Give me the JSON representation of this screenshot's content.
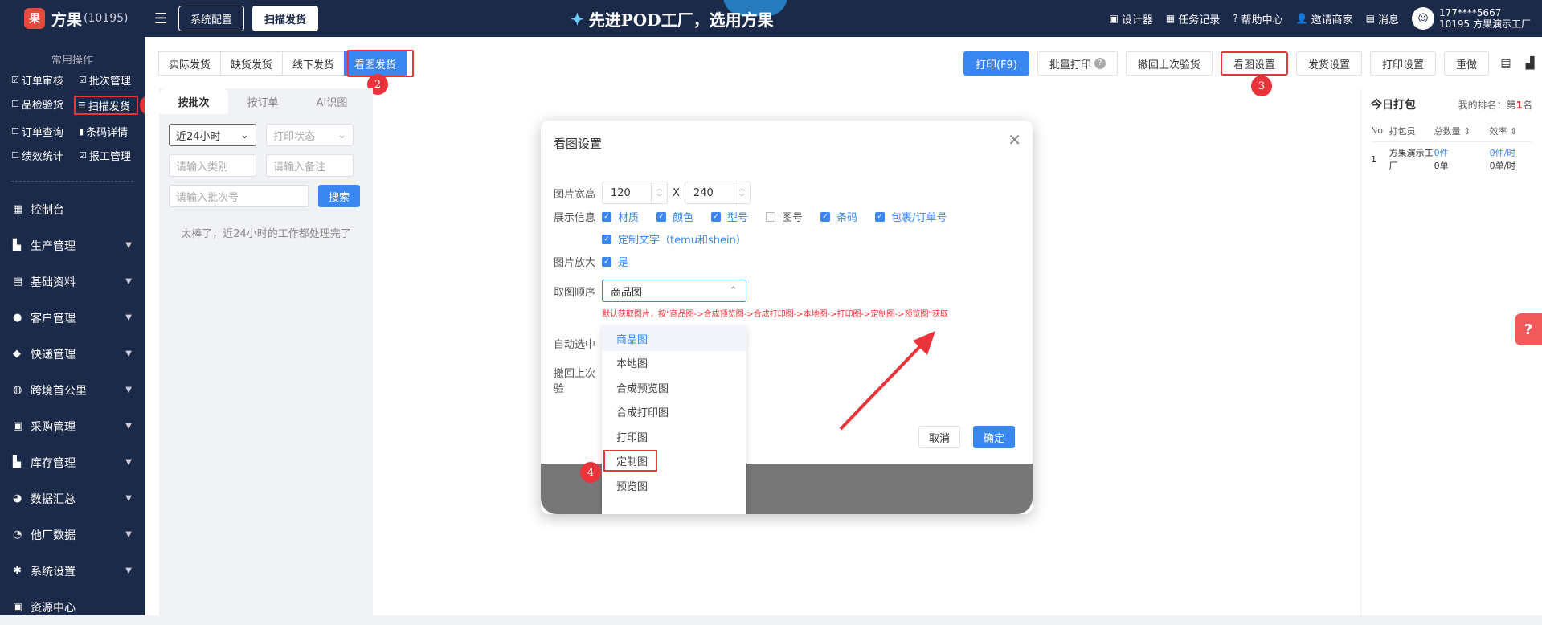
{
  "header": {
    "logo_icon": "果",
    "logo_text": "方果",
    "logo_count": "(10195)",
    "menu_icon": "☰",
    "nav_buttons": [
      "系统配置",
      "扫描发货"
    ],
    "slogan": "先进POD工厂，选用方果",
    "links": [
      {
        "icon": "image-icon",
        "glyph": "▣",
        "label": "设计器"
      },
      {
        "icon": "task-icon",
        "glyph": "▦",
        "label": "任务记录"
      },
      {
        "icon": "help-icon",
        "glyph": "?",
        "label": "帮助中心"
      },
      {
        "icon": "invite-icon",
        "glyph": "👤",
        "label": "邀请商家"
      },
      {
        "icon": "message-icon",
        "glyph": "▤",
        "label": "消息"
      }
    ],
    "user": {
      "phone": "177****5667",
      "company": "10195 方果演示工厂"
    }
  },
  "sidebar": {
    "quick_title": "常用操作",
    "quick_items": [
      {
        "label": "订单审核",
        "glyph": "☑"
      },
      {
        "label": "批次管理",
        "glyph": "☑"
      },
      {
        "label": "品检验货",
        "glyph": "☐"
      },
      {
        "label": "扫描发货",
        "glyph": "☰"
      },
      {
        "label": "订单查询",
        "glyph": "☐"
      },
      {
        "label": "条码详情",
        "glyph": "▮"
      },
      {
        "label": "绩效统计",
        "glyph": "☐"
      },
      {
        "label": "报工管理",
        "glyph": "☑"
      }
    ],
    "nav_items": [
      {
        "label": "控制台",
        "icon": "dashboard-icon",
        "glyph": "▦",
        "chevron": false
      },
      {
        "label": "生产管理",
        "icon": "production-icon",
        "glyph": "▙",
        "chevron": true
      },
      {
        "label": "基础资料",
        "icon": "database-icon",
        "glyph": "▤",
        "chevron": true
      },
      {
        "label": "客户管理",
        "icon": "customer-icon",
        "glyph": "●",
        "chevron": true
      },
      {
        "label": "快递管理",
        "icon": "express-icon",
        "glyph": "◆",
        "chevron": true
      },
      {
        "label": "跨境首公里",
        "icon": "globe-icon",
        "glyph": "◍",
        "chevron": true
      },
      {
        "label": "采购管理",
        "icon": "purchase-icon",
        "glyph": "▣",
        "chevron": true
      },
      {
        "label": "库存管理",
        "icon": "inventory-icon",
        "glyph": "▙",
        "chevron": true
      },
      {
        "label": "数据汇总",
        "icon": "chart-icon",
        "glyph": "◕",
        "chevron": true
      },
      {
        "label": "他厂数据",
        "icon": "other-factory-icon",
        "glyph": "◔",
        "chevron": true
      },
      {
        "label": "系统设置",
        "icon": "settings-icon",
        "glyph": "✱",
        "chevron": true
      },
      {
        "label": "资源中心",
        "icon": "resource-icon",
        "glyph": "▣",
        "chevron": false
      }
    ]
  },
  "tabs": [
    "实际发货",
    "缺货发货",
    "线下发货",
    "看图发货"
  ],
  "actions": {
    "print": "打印(F9)",
    "batch_print": "批量打印",
    "undo_check": "撤回上次验货",
    "view_settings": "看图设置",
    "ship_settings": "发货设置",
    "print_settings": "打印设置",
    "redo": "重做"
  },
  "badges": [
    "1",
    "2",
    "3",
    "4"
  ],
  "left_panel": {
    "tabs": [
      "按批次",
      "按订单",
      "AI识图"
    ],
    "time_select": "近24小时",
    "print_status_placeholder": "打印状态",
    "category_placeholder": "请输入类别",
    "remark_placeholder": "请输入备注",
    "batch_placeholder": "请输入批次号",
    "search_button": "搜索",
    "empty_text": "太棒了，近24小时的工作都处理完了"
  },
  "right_panel": {
    "title": "今日打包",
    "rank_prefix": "我的排名：第",
    "rank_value": "1",
    "rank_suffix": "名",
    "columns": [
      "No",
      "打包员",
      "总数量",
      "效率"
    ],
    "rows": [
      {
        "no": "1",
        "packer": "方果演示工厂",
        "total_pcs": "0件",
        "total_orders": "0单",
        "eff_pcs": "0件/时",
        "eff_orders": "0单/时"
      }
    ]
  },
  "dialog": {
    "title": "看图设置",
    "size_label": "图片宽高",
    "width": "120",
    "height": "240",
    "times": "X",
    "info_label": "展示信息",
    "info_options": [
      {
        "label": "材质",
        "checked": true
      },
      {
        "label": "颜色",
        "checked": true
      },
      {
        "label": "型号",
        "checked": true
      },
      {
        "label": "图号",
        "checked": false
      },
      {
        "label": "条码",
        "checked": true
      },
      {
        "label": "包裹/订单号",
        "checked": true
      }
    ],
    "custom_text_option": "定制文字（temu和shein）",
    "zoom_label": "图片放大",
    "zoom_value": "是",
    "order_label": "取图顺序",
    "order_value": "商品图",
    "hint": "默认获取图片，按\"商品图->合成预览图->合成打印图->本地图->打印图->定制图->预览图\"获取",
    "auto_select_label": "自动选中",
    "undo_label": "撤回上次验",
    "dropdown_options": [
      "商品图",
      "本地图",
      "合成预览图",
      "合成打印图",
      "打印图",
      "定制图",
      "预览图"
    ],
    "cancel": "取消",
    "confirm": "确定"
  },
  "colors": {
    "sidebar_bg": "#1c2a49",
    "primary": "#3a87f2",
    "highlight": "#e8343a"
  }
}
